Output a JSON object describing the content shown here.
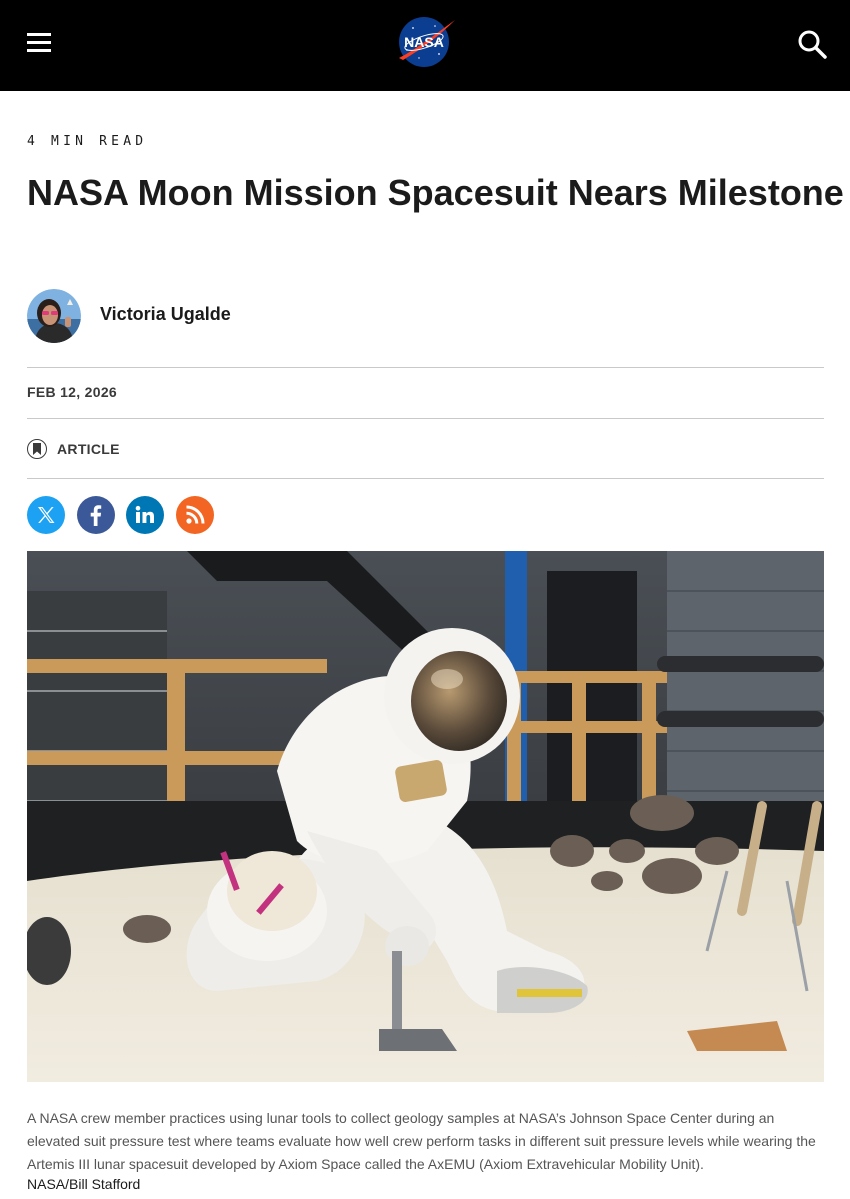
{
  "header": {
    "menu_icon": "hamburger-menu-icon",
    "logo_text": "NASA",
    "search_icon": "search-icon"
  },
  "article": {
    "read_time": "4 MIN READ",
    "title": "NASA Moon Mission Spacesuit Nears Milestone",
    "author_name": "Victoria Ugalde",
    "date": "FEB 12, 2026",
    "type_label": "ARTICLE",
    "type_icon": "bookmark-icon"
  },
  "share": [
    {
      "icon": "x-twitter-icon",
      "color": "#1da1f2"
    },
    {
      "icon": "facebook-icon",
      "color": "#3b5998"
    },
    {
      "icon": "linkedin-icon",
      "color": "#0077b5"
    },
    {
      "icon": "rss-icon",
      "color": "#f26522"
    }
  ],
  "image": {
    "caption": "A NASA crew member practices using lunar tools to collect geology samples at NASA’s Johnson Space Center during an elevated suit pressure test where teams evaluate how well crew perform tasks in different suit pressure levels while wearing the Artemis III lunar spacesuit developed by Axiom Space called the AxEMU (Axiom Extravehicular Mobility Unit).",
    "credit": "NASA/Bill Stafford"
  }
}
